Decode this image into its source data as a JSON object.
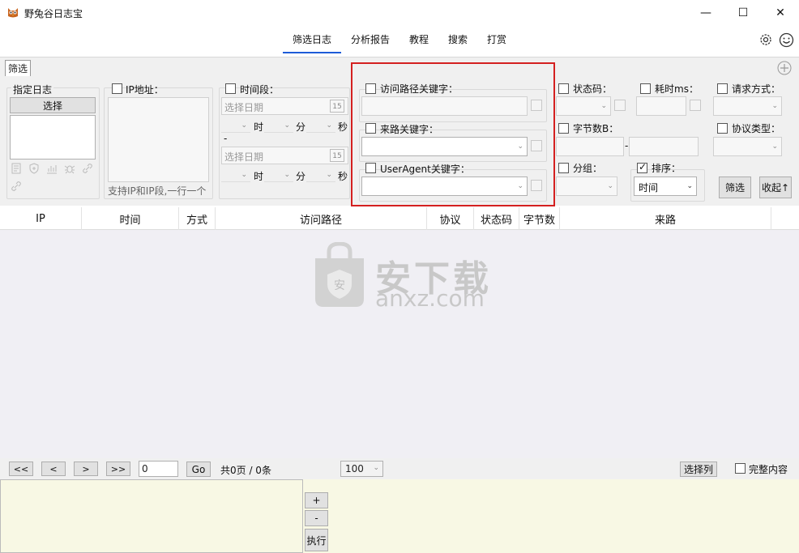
{
  "window": {
    "title": "野兔谷日志宝",
    "minimize": "—",
    "maximize": "☐",
    "close": "✕"
  },
  "menu": {
    "items": [
      "筛选日志",
      "分析报告",
      "教程",
      "搜索",
      "打赏"
    ]
  },
  "filter_tab": "筛选",
  "specify_log": {
    "label": "指定日志",
    "select_button": "选择"
  },
  "ip": {
    "label": "IP地址：",
    "hint": "支持IP和IP段,一行一个"
  },
  "time_range": {
    "label": "时间段：",
    "date_placeholder": "选择日期",
    "calendar_day": "15",
    "hour": "时",
    "minute": "分",
    "second": "秒",
    "dash": "-"
  },
  "path_keyword": {
    "label": "访问路径关键字："
  },
  "referer_keyword": {
    "label": "来路关键字："
  },
  "useragent_keyword": {
    "label": "UserAgent关键字："
  },
  "status_code": {
    "label": "状态码："
  },
  "time_ms": {
    "label": "耗时ms："
  },
  "request_method": {
    "label": "请求方式："
  },
  "bytes": {
    "label": "字节数B：",
    "dash": "-"
  },
  "protocol_type": {
    "label": "协议类型："
  },
  "group": {
    "label": "分组："
  },
  "sort": {
    "label": "排序：",
    "value": "时间",
    "checked": true
  },
  "buttons": {
    "filter": "筛选",
    "collapse": "收起↑"
  },
  "table": {
    "columns": [
      "IP",
      "时间",
      "方式",
      "访问路径",
      "协议",
      "状态码",
      "字节数",
      "来路"
    ]
  },
  "watermark": {
    "main": "安下载",
    "sub": "anxz.com",
    "badge": "安"
  },
  "pager": {
    "first": "<<",
    "prev": "<",
    "next": ">",
    "last": ">>",
    "page_input": "0",
    "go": "Go",
    "summary": "共0页 / 0条",
    "page_size": "100",
    "select_columns": "选择列",
    "full_content": "完整内容"
  },
  "bottom": {
    "plus": "+",
    "minus": "-",
    "execute": "执行"
  }
}
